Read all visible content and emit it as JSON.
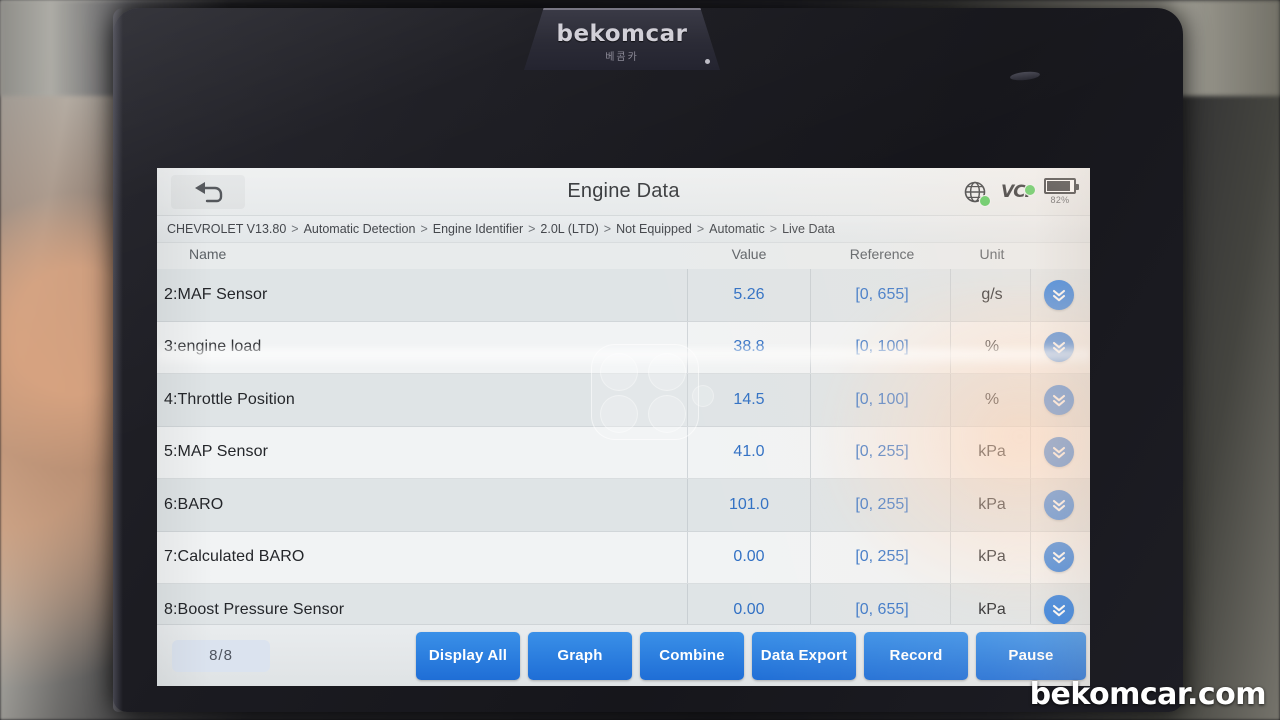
{
  "device": {
    "brand_plate": "bekomcar",
    "brand_plate_sub": "베콤카"
  },
  "watermark": "bekomcar.com",
  "titlebar": {
    "back_icon": "back-arrow-icon",
    "title": "Engine Data",
    "globe_icon": "globe-icon",
    "vci_label": "VCI",
    "battery_percent": "82%",
    "battery_level": 82
  },
  "breadcrumb": {
    "items": [
      "CHEVROLET V13.80",
      "Automatic Detection",
      "Engine Identifier",
      "2.0L (LTD)",
      "Not Equipped",
      "Automatic",
      "Live Data"
    ],
    "separator": ">"
  },
  "table": {
    "headers": {
      "name": "Name",
      "value": "Value",
      "reference": "Reference",
      "unit": "Unit"
    },
    "rows": [
      {
        "name": "2:MAF Sensor",
        "value": "5.26",
        "reference": "[0, 655]",
        "unit": "g/s"
      },
      {
        "name": "3:engine load",
        "value": "38.8",
        "reference": "[0, 100]",
        "unit": "%"
      },
      {
        "name": "4:Throttle Position",
        "value": "14.5",
        "reference": "[0, 100]",
        "unit": "%"
      },
      {
        "name": "5:MAP Sensor",
        "value": "41.0",
        "reference": "[0, 255]",
        "unit": "kPa"
      },
      {
        "name": "6:BARO",
        "value": "101.0",
        "reference": "[0, 255]",
        "unit": "kPa"
      },
      {
        "name": "7:Calculated BARO",
        "value": "0.00",
        "reference": "[0, 255]",
        "unit": "kPa"
      },
      {
        "name": "8:Boost Pressure Sensor",
        "value": "0.00",
        "reference": "[0, 655]",
        "unit": "kPa"
      }
    ],
    "expand_icon": "chevron-double-down-icon"
  },
  "bottombar": {
    "page_indicator": "8/8",
    "buttons": [
      "Display All",
      "Graph",
      "Combine",
      "Data Export",
      "Record",
      "Pause"
    ]
  },
  "colors": {
    "accent_blue": "#2b7de0",
    "value_blue": "#2f6fc4",
    "status_green": "#4cc552",
    "screen_bg": "#eef0f1"
  }
}
